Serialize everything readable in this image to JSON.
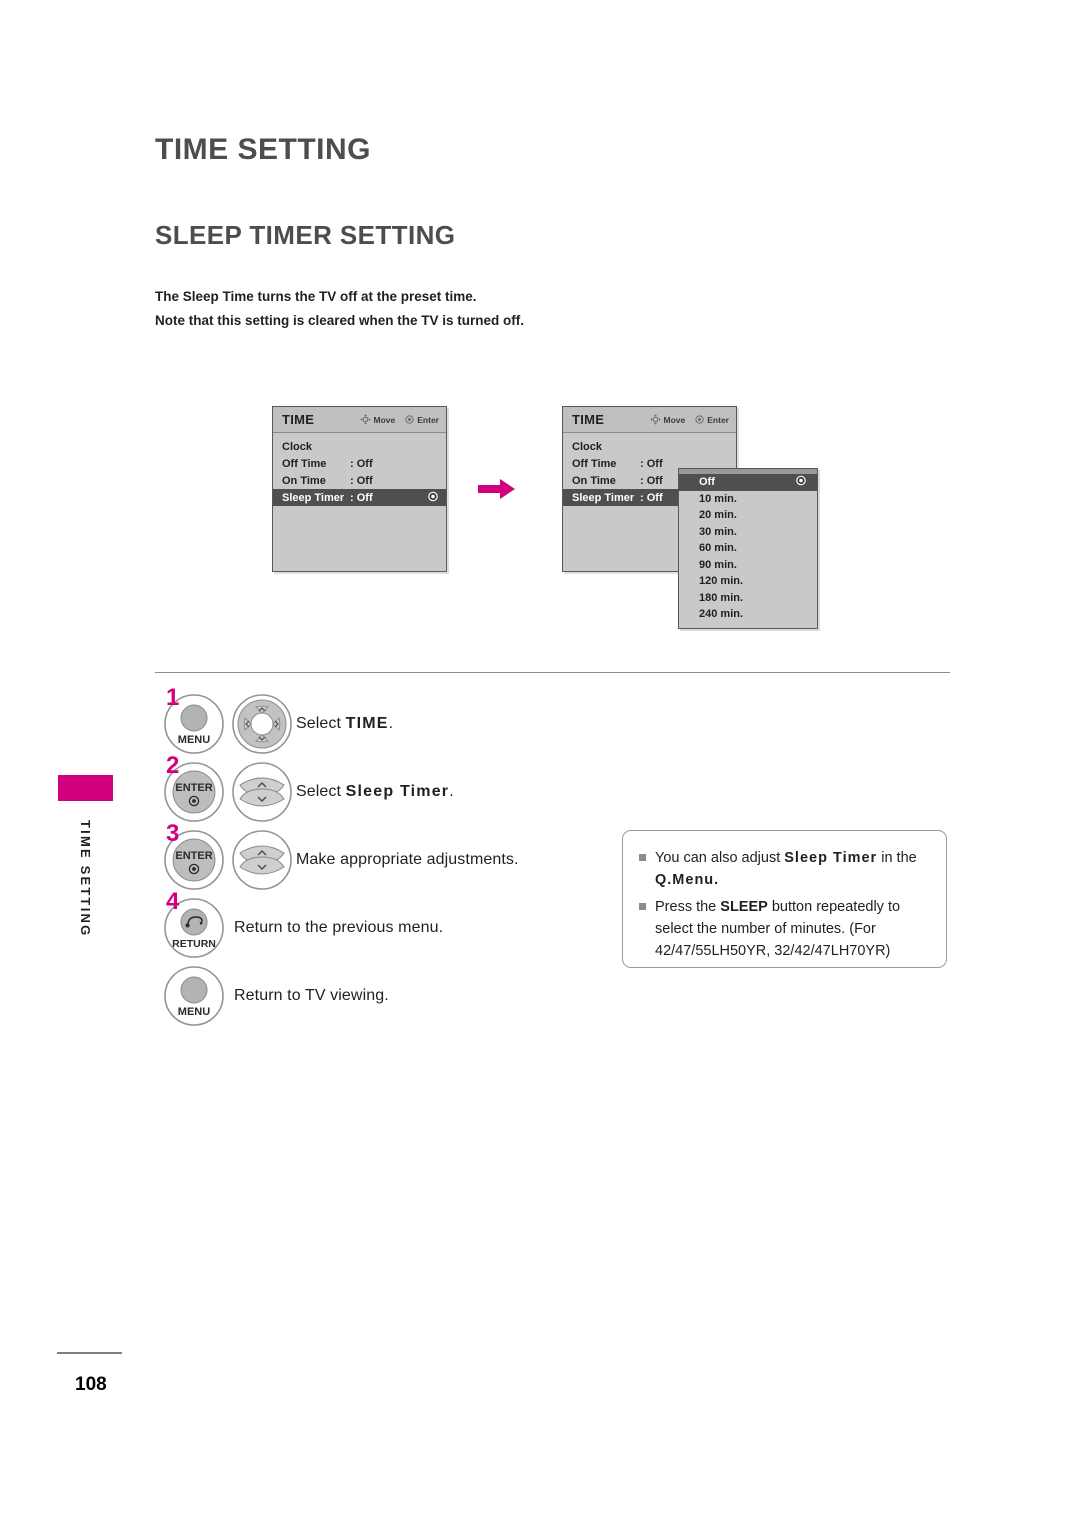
{
  "header": {
    "chapter_title": "TIME SETTING",
    "section_title": "SLEEP TIMER SETTING"
  },
  "intro": {
    "line1": "The Sleep Time turns the TV off at the preset time.",
    "line2": "Note that this setting is cleared when the TV is turned off."
  },
  "side_rail": {
    "label": "TIME SETTING"
  },
  "footer": {
    "page_number": "108"
  },
  "osd": {
    "title": "TIME",
    "hint_move": "Move",
    "hint_enter": "Enter",
    "rows": [
      {
        "label": "Clock",
        "value": ""
      },
      {
        "label": "Off Time",
        "value": ": Off"
      },
      {
        "label": "On Time",
        "value": ": Off"
      },
      {
        "label": "Sleep Timer",
        "value": ": Off"
      }
    ],
    "selected_row_index": 3
  },
  "dropdown": {
    "items": [
      "Off",
      "10 min.",
      "20 min.",
      "30 min.",
      "60 min.",
      "90 min.",
      "120 min.",
      "180 min.",
      "240 min."
    ],
    "selected_index": 0
  },
  "steps": [
    {
      "number": "1",
      "button_label": "MENU",
      "button_type": "round",
      "pad_type": "four-way",
      "text_pre": "Select ",
      "text_bold": "TIME",
      "text_post": "."
    },
    {
      "number": "2",
      "button_label": "ENTER",
      "button_type": "enter",
      "pad_type": "up-down",
      "text_pre": "Select ",
      "text_bold": "Sleep Timer",
      "text_post": "."
    },
    {
      "number": "3",
      "button_label": "ENTER",
      "button_type": "enter",
      "pad_type": "up-down",
      "text_pre": "Make appropriate adjustments.",
      "text_bold": "",
      "text_post": ""
    },
    {
      "number": "4",
      "button_label": "RETURN",
      "button_type": "return",
      "pad_type": "none",
      "text_pre": "Return to the previous menu.",
      "text_bold": "",
      "text_post": ""
    },
    {
      "number": "",
      "button_label": "MENU",
      "button_type": "round",
      "pad_type": "none",
      "text_pre": "Return to TV viewing.",
      "text_bold": "",
      "text_post": ""
    }
  ],
  "note": {
    "item1_pre": "You can also adjust ",
    "item1_bold": "Sleep Timer",
    "item1_mid": " in the ",
    "item1_bold2": "Q.Menu.",
    "item2_pre": "Press the ",
    "item2_bold": "SLEEP",
    "item2_post": " button repeatedly to select the number of minutes. (For 42/47/55LH50YR, 32/42/47LH70YR)"
  },
  "colors": {
    "accent": "#d1007f",
    "osd_selected": "#4f4f4f",
    "osd_body": "#c9c9c9",
    "osd_header": "#c0c0c0"
  }
}
